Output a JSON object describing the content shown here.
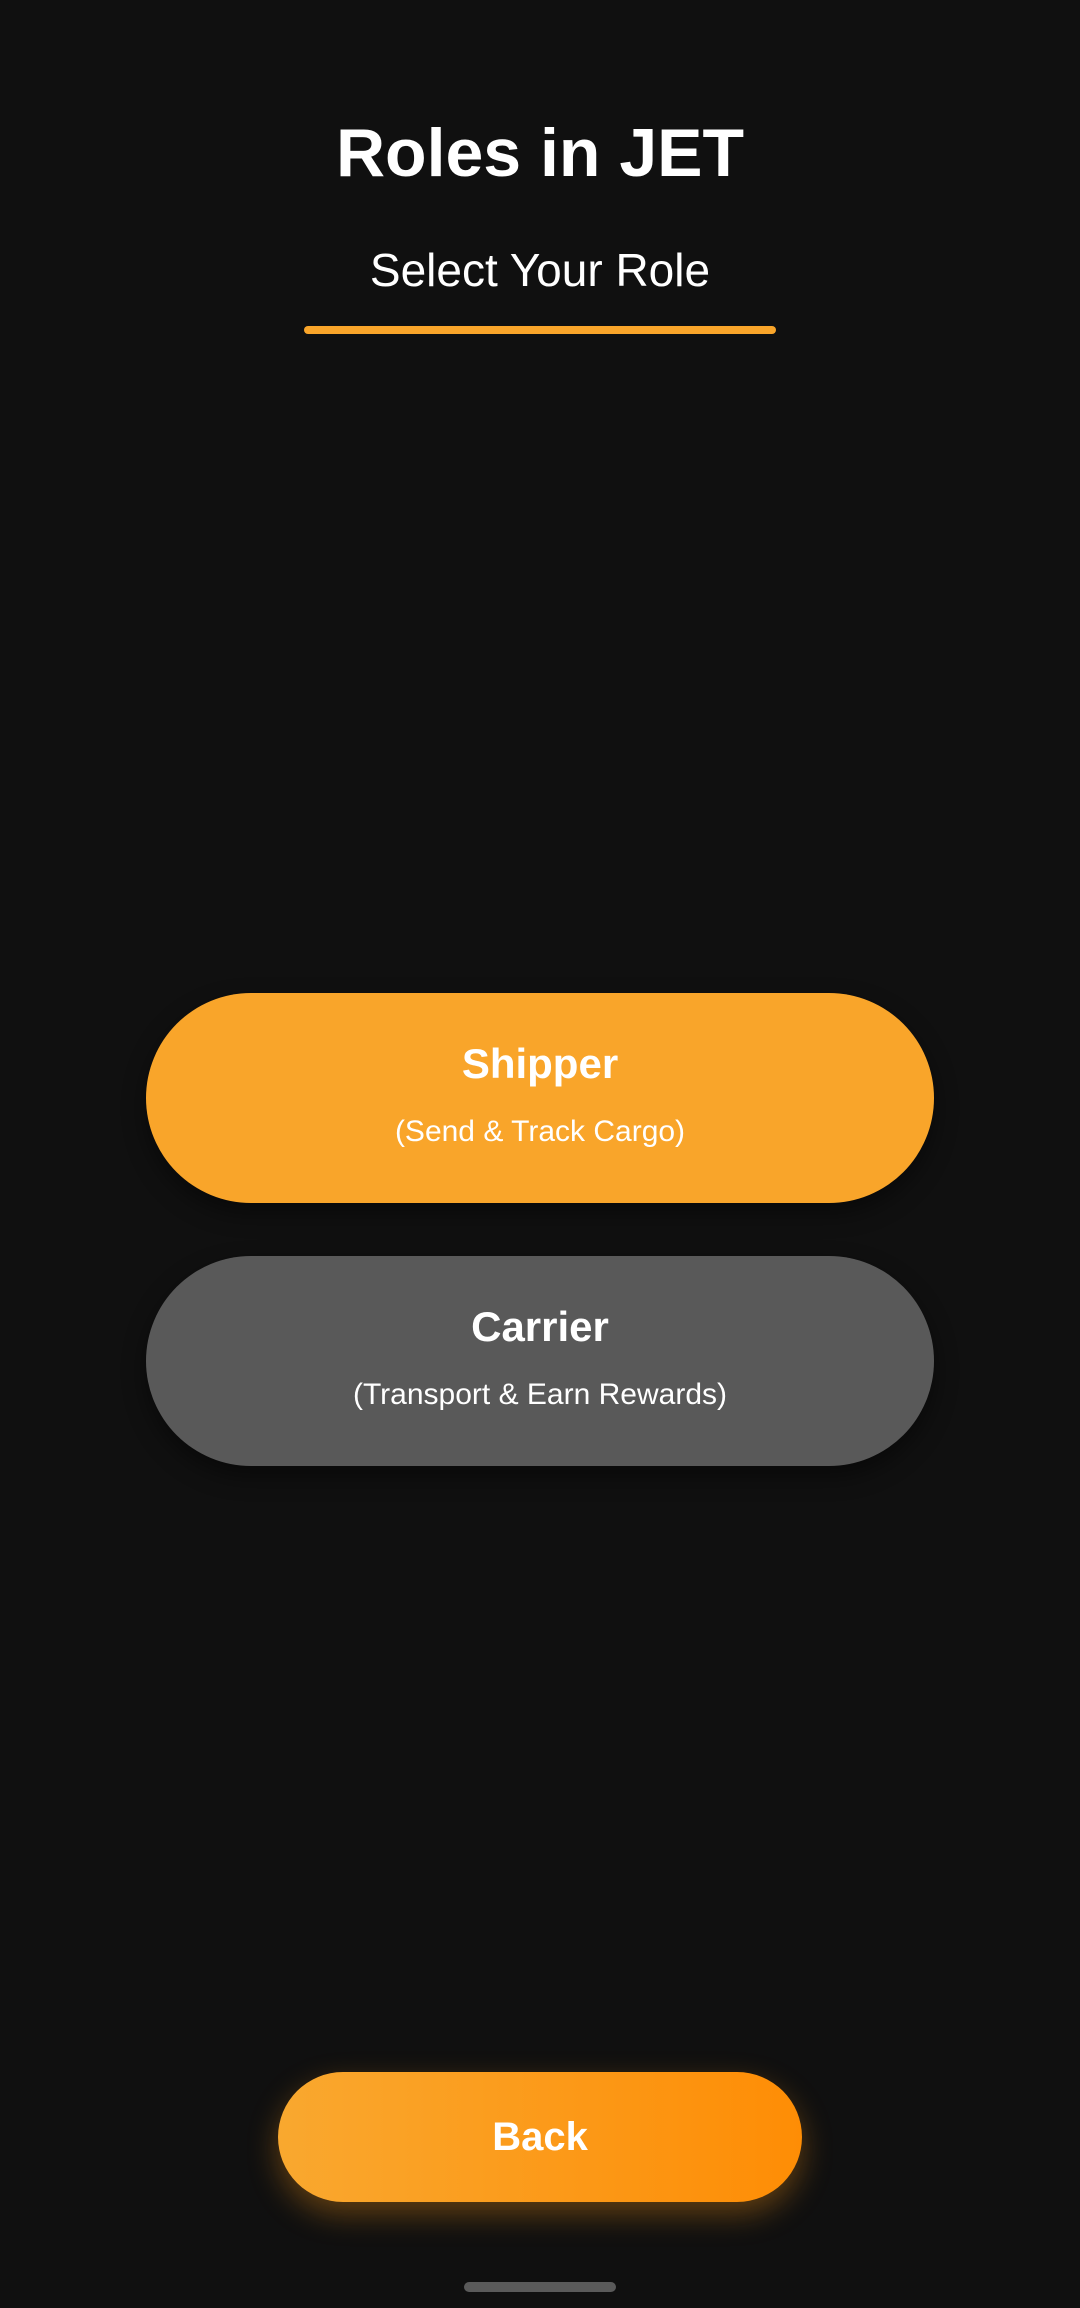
{
  "header": {
    "title": "Roles in JET",
    "subtitle": "Select Your Role"
  },
  "roles": [
    {
      "name": "Shipper",
      "description": "(Send & Track Cargo)",
      "color": "#F9A52A"
    },
    {
      "name": "Carrier",
      "description": "(Transport & Earn Rewards)",
      "color": "#595959"
    }
  ],
  "footer": {
    "back_label": "Back"
  },
  "colors": {
    "background": "#101010",
    "accent": "#F9A52A",
    "accent_dark": "#FE8D05",
    "secondary": "#595959"
  }
}
